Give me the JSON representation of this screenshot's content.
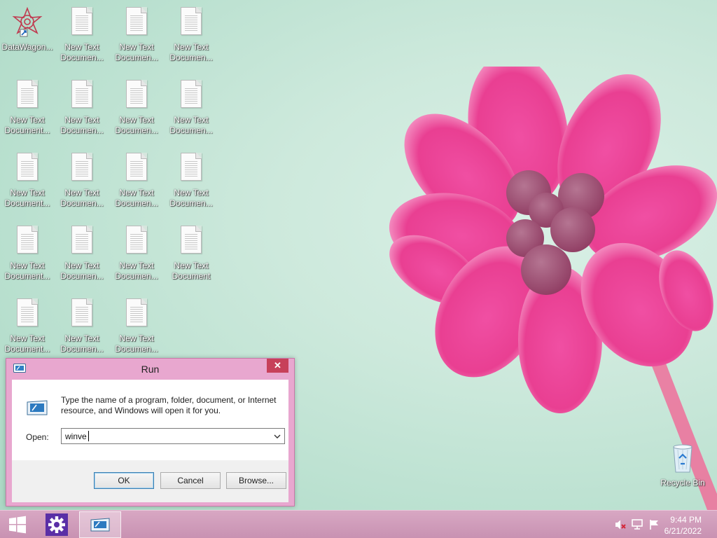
{
  "desktop": {
    "shortcut": {
      "label": "DataWagon...",
      "icon": "datawagon-shortcut-icon"
    },
    "text_files": [
      {
        "label": "New Text Documen..."
      },
      {
        "label": "New Text Documen..."
      },
      {
        "label": "New Text Documen..."
      },
      {
        "label": "New Text Document..."
      },
      {
        "label": "New Text Documen..."
      },
      {
        "label": "New Text Documen..."
      },
      {
        "label": "New Text Documen..."
      },
      {
        "label": "New Text Document..."
      },
      {
        "label": "New Text Documen..."
      },
      {
        "label": "New Text Documen..."
      },
      {
        "label": "New Text Documen..."
      },
      {
        "label": "New Text Document..."
      },
      {
        "label": "New Text Documen..."
      },
      {
        "label": "New Text Documen..."
      },
      {
        "label": "New Text Document"
      },
      {
        "label": "New Text Document..."
      },
      {
        "label": "New Text Documen..."
      },
      {
        "label": "New Text Documen..."
      }
    ],
    "recycle_bin": {
      "label": "Recycle Bin"
    }
  },
  "run_dialog": {
    "title": "Run",
    "close_glyph": "✕",
    "description": "Type the name of a program, folder, document, or Internet resource, and Windows will open it for you.",
    "open_label": "Open:",
    "open_value": "winve",
    "buttons": {
      "ok": "OK",
      "cancel": "Cancel",
      "browse": "Browse..."
    }
  },
  "taskbar": {
    "clock_time": "9:44 PM",
    "clock_date": "6/21/2022"
  },
  "colors": {
    "taskbar": "#c892b2",
    "dialog_frame": "#e8a7cf",
    "close_button": "#c7405a"
  }
}
